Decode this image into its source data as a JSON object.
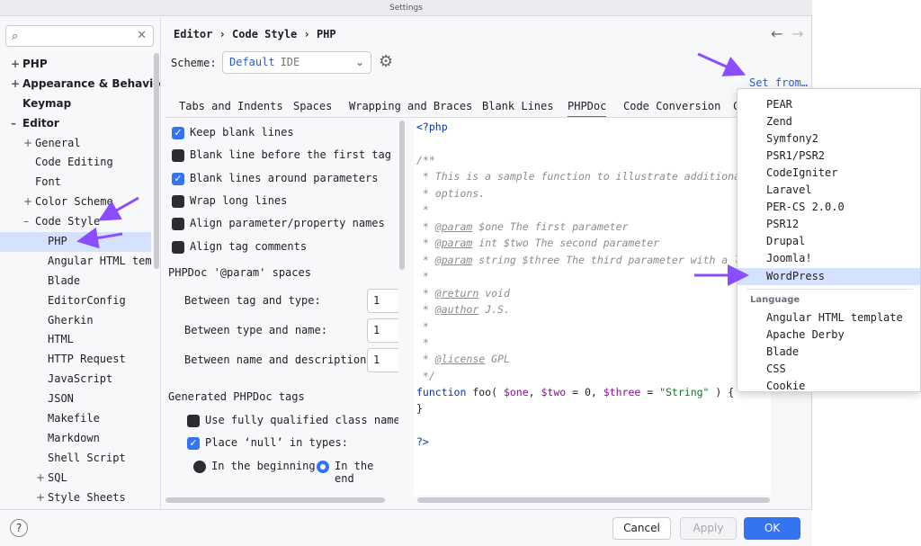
{
  "window": {
    "title": "Settings"
  },
  "search": {
    "placeholder": "",
    "search_icon": "search-icon",
    "clear_icon": "close-icon"
  },
  "sidebar": {
    "items": [
      {
        "label": "PHP",
        "toggle": "+",
        "level": 0,
        "bold": true
      },
      {
        "label": "Appearance & Behavio",
        "toggle": "+",
        "level": 0,
        "bold": true
      },
      {
        "label": "Keymap",
        "toggle": "",
        "level": 0,
        "bold": true
      },
      {
        "label": "Editor",
        "toggle": "–",
        "level": 0,
        "bold": true
      },
      {
        "label": "General",
        "toggle": "+",
        "level": 1
      },
      {
        "label": "Code Editing",
        "toggle": "",
        "level": 1
      },
      {
        "label": "Font",
        "toggle": "",
        "level": 1
      },
      {
        "label": "Color Scheme",
        "toggle": "+",
        "level": 1
      },
      {
        "label": "Code Style",
        "toggle": "–",
        "level": 1
      },
      {
        "label": "PHP",
        "toggle": "",
        "level": 2,
        "selected": true
      },
      {
        "label": "Angular HTML tem",
        "toggle": "",
        "level": 2
      },
      {
        "label": "Blade",
        "toggle": "",
        "level": 2
      },
      {
        "label": "EditorConfig",
        "toggle": "",
        "level": 2
      },
      {
        "label": "Gherkin",
        "toggle": "",
        "level": 2
      },
      {
        "label": "HTML",
        "toggle": "",
        "level": 2
      },
      {
        "label": "HTTP Request",
        "toggle": "",
        "level": 2
      },
      {
        "label": "JavaScript",
        "toggle": "",
        "level": 2
      },
      {
        "label": "JSON",
        "toggle": "",
        "level": 2
      },
      {
        "label": "Makefile",
        "toggle": "",
        "level": 2
      },
      {
        "label": "Markdown",
        "toggle": "",
        "level": 2
      },
      {
        "label": "Shell Script",
        "toggle": "",
        "level": 2
      },
      {
        "label": "SQL",
        "toggle": "+",
        "level": 2
      },
      {
        "label": "Style Sheets",
        "toggle": "+",
        "level": 2
      }
    ]
  },
  "header": {
    "breadcrumb": "Editor › Code Style › PHP",
    "back_icon": "←",
    "forward_icon": "→"
  },
  "scheme": {
    "label": "Scheme:",
    "value": "Default",
    "tag": "IDE",
    "chevron": "⌄",
    "gear_icon": "⚙",
    "set_from": "Set from…"
  },
  "tabs": [
    {
      "label": "Tabs and Indents"
    },
    {
      "label": "Spaces"
    },
    {
      "label": "Wrapping and Braces"
    },
    {
      "label": "Blank Lines"
    },
    {
      "label": "PHPDoc",
      "active": true
    },
    {
      "label": "Code Conversion"
    },
    {
      "label": "C"
    }
  ],
  "options": {
    "checkboxes": [
      {
        "label": "Keep blank lines",
        "checked": true
      },
      {
        "label": "Blank line before the first tag",
        "checked": false
      },
      {
        "label": "Blank lines around parameters",
        "checked": true
      },
      {
        "label": "Wrap long lines",
        "checked": false
      },
      {
        "label": "Align parameter/property names",
        "checked": false
      },
      {
        "label": "Align tag comments",
        "checked": false
      }
    ],
    "param_section": "PHPDoc '@param' spaces",
    "fields": [
      {
        "label": "Between tag and type:",
        "value": "1"
      },
      {
        "label": "Between type and name:",
        "value": "1"
      },
      {
        "label": "Between name and description:",
        "value": "1"
      }
    ],
    "generated_section": "Generated PHPDoc tags",
    "generated": [
      {
        "label": "Use fully qualified class names",
        "checked": false
      },
      {
        "label": "Place ‘null’ in types:",
        "checked": true
      }
    ],
    "radios": [
      {
        "label": "In the beginning",
        "selected": false
      },
      {
        "label": "In the end",
        "selected": true
      }
    ]
  },
  "code": {
    "open_tag": "<?php",
    "doc_open": "/**",
    "desc1": " * This is a sample function to illustrate additional ",
    "desc2": " * options.",
    "star": " *",
    "param_tag": "@param",
    "param1": " $one The first parameter",
    "param2": " int $two The second parameter",
    "param3": " string $three The third parameter with a lon",
    "return_tag": "@return",
    "return_rest": " void",
    "author_tag": "@author",
    "author_rest": " J.S.",
    "license_tag": "@license",
    "license_rest": " GPL",
    "doc_close": " */",
    "fn_kw": "function",
    "fn_name": " foo( ",
    "v_one": "$one",
    "comma1": ", ",
    "v_two": "$two",
    "eq0": " = 0, ",
    "v_three": "$three",
    "eq_str": " = ",
    "str_val": "\"String\"",
    "fn_end": " ) {",
    "close_brace": "}",
    "close_tag": "?>"
  },
  "footer": {
    "help": "?",
    "cancel": "Cancel",
    "apply": "Apply",
    "ok": "OK"
  },
  "popup": {
    "schemes": [
      "PEAR",
      "Zend",
      "Symfony2",
      "PSR1/PSR2",
      "CodeIgniter",
      "Laravel",
      "PER-CS 2.0.0",
      "PSR12",
      "Drupal",
      "Joomla!",
      "WordPress"
    ],
    "highlighted": "WordPress",
    "group_label": "Language",
    "languages": [
      "Angular HTML template",
      "Apache Derby",
      "Blade",
      "CSS",
      "Cookie"
    ]
  },
  "colors": {
    "accent": "#3574f0",
    "selection": "#d4e2ff",
    "link": "#2a5bd7",
    "annotation_arrow": "#8a4dff"
  }
}
